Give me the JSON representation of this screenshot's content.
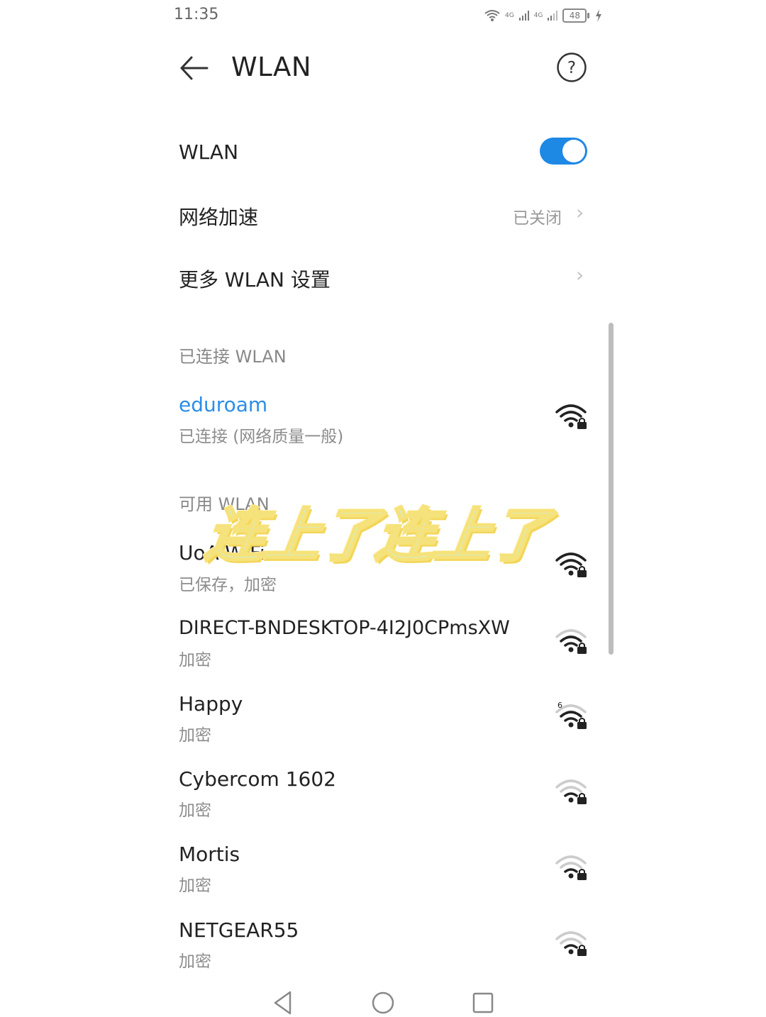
{
  "status_bar": {
    "time": "11:35",
    "net1": "4G",
    "net2": "4G",
    "battery": "48"
  },
  "header": {
    "title": "WLAN"
  },
  "settings": {
    "wlan_label": "WLAN",
    "wlan_enabled": true,
    "accel_label": "网络加速",
    "accel_value": "已关闭",
    "more_label": "更多 WLAN 设置"
  },
  "connected": {
    "section_title": "已连接 WLAN",
    "ssid": "eduroam",
    "status": "已连接 (网络质量一般)"
  },
  "available": {
    "section_title": "可用 WLAN",
    "networks": [
      {
        "ssid": "UoA-WiFi",
        "status": "已保存，加密"
      },
      {
        "ssid": "DIRECT-BNDESKTOP-4I2J0CPmsXW",
        "status": "加密"
      },
      {
        "ssid": "Happy",
        "status": "加密",
        "band": "6"
      },
      {
        "ssid": "Cybercom 1602",
        "status": "加密"
      },
      {
        "ssid": "Mortis",
        "status": "加密"
      },
      {
        "ssid": "NETGEAR55",
        "status": "加密"
      }
    ]
  },
  "overlay_text": "连上了连上了",
  "colors": {
    "accent": "#1e88e5",
    "connected_text": "#2a8ee8"
  }
}
